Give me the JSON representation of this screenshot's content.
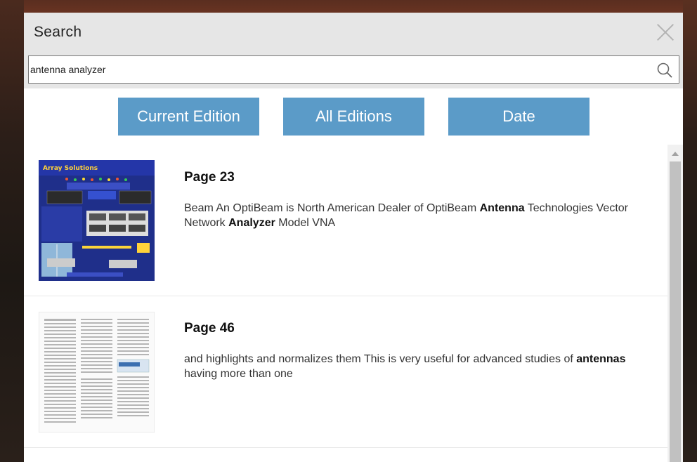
{
  "modal": {
    "title": "Search",
    "close_icon": "close-icon"
  },
  "search": {
    "value": "antenna analyzer",
    "icon": "search-icon"
  },
  "tabs": [
    {
      "label": "Current Edition"
    },
    {
      "label": "All Editions"
    },
    {
      "label": "Date"
    }
  ],
  "results": [
    {
      "page": "Page 23",
      "snippet_parts": [
        {
          "text": "Beam An OptiBeam is North American Dealer of OptiBeam ",
          "bold": false
        },
        {
          "text": "Antenna",
          "bold": true
        },
        {
          "text": " Technologies Vector Network ",
          "bold": false
        },
        {
          "text": "Analyzer",
          "bold": true
        },
        {
          "text": " Model VNA",
          "bold": false
        }
      ],
      "thumb_title": "Array Solutions"
    },
    {
      "page": "Page 46",
      "snippet_parts": [
        {
          "text": "and highlights and normalizes them This is very useful for advanced studies of ",
          "bold": false
        },
        {
          "text": "antennas",
          "bold": true
        },
        {
          "text": " having more than one",
          "bold": false
        }
      ]
    }
  ],
  "colors": {
    "tab_bg": "#5b9bc8",
    "header_bg": "#e6e6e6"
  }
}
